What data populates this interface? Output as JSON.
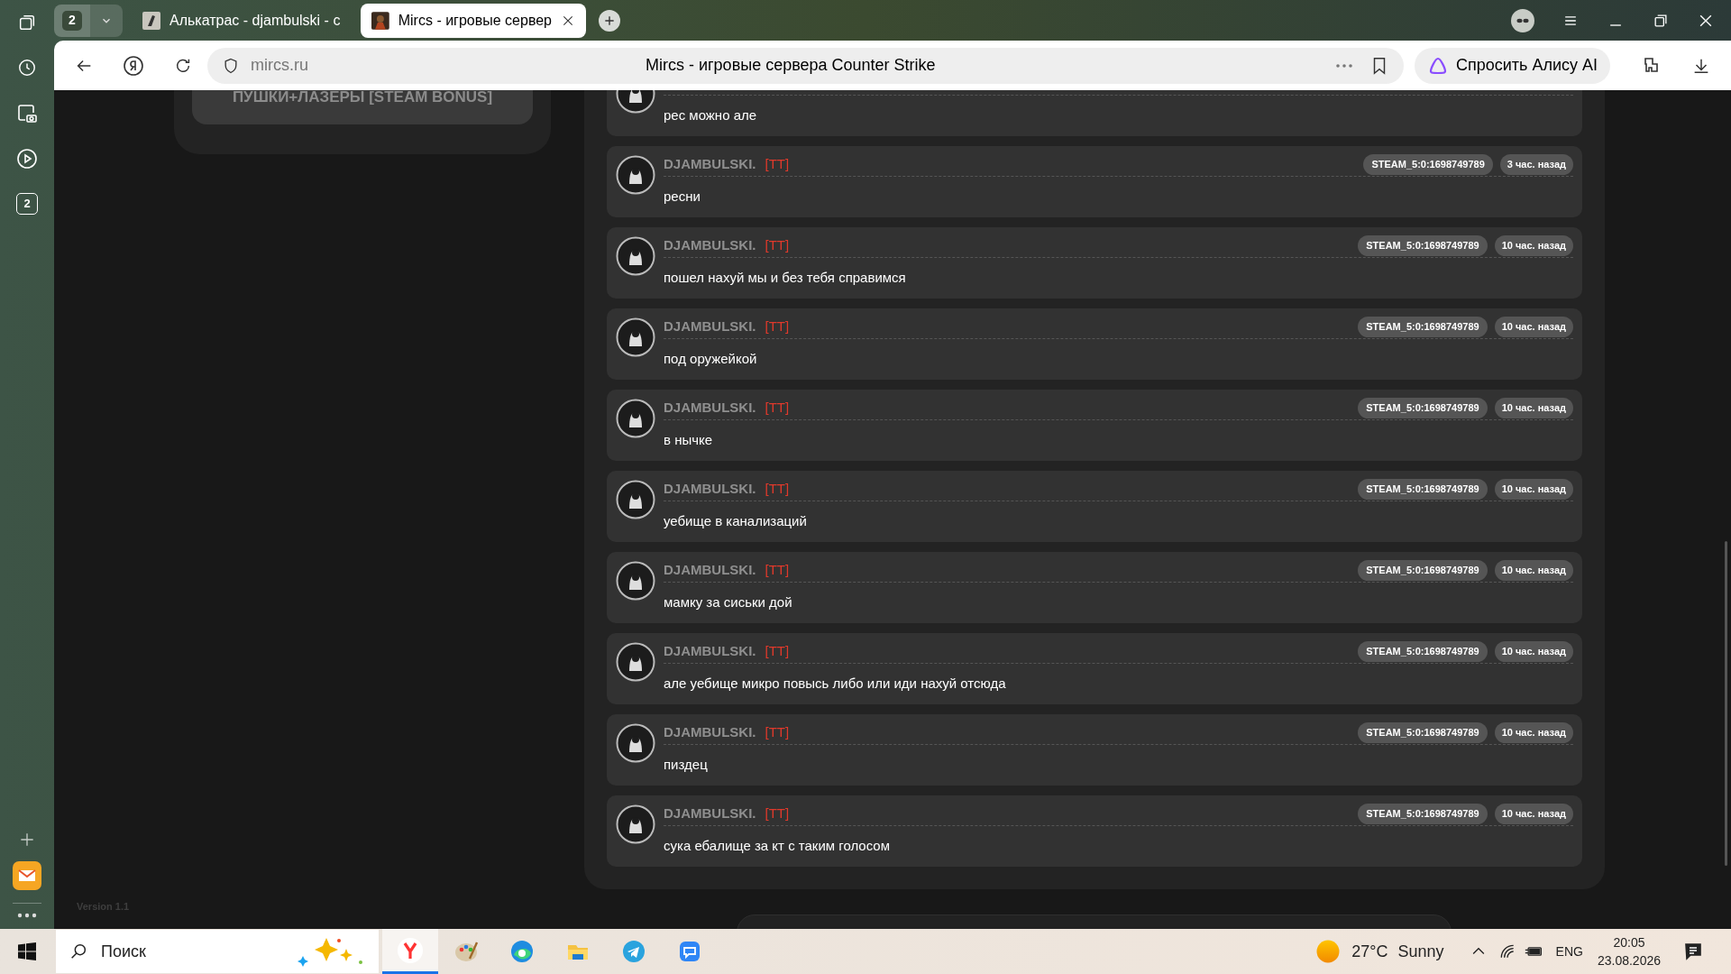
{
  "browser": {
    "tab_count": "2",
    "tabs": [
      {
        "title": "Алькатрас - djambulski - с",
        "selected": false
      },
      {
        "title": "Mircs - игровые сервер",
        "selected": true
      }
    ],
    "address": "mircs.ru",
    "page_title": "Mircs - игровые сервера Counter Strike",
    "assistant_button": "Спросить Алису AI",
    "sidebar_badge": "2"
  },
  "server_panel": {
    "button": "ПУШКИ+ЛАЗЕРЫ [STEAM BONUS]"
  },
  "messages": [
    {
      "text": "рес можно але"
    },
    {
      "name": "DJAMBULSKI.",
      "team": "[TT]",
      "steam_id": "STEAM_5:0:1698749789",
      "time": "3 час. назад",
      "text": "ресни"
    },
    {
      "name": "DJAMBULSKI.",
      "team": "[TT]",
      "steam_id": "STEAM_5:0:1698749789",
      "time": "10 час. назад",
      "text": "пошел нахуй мы и без тебя справимся"
    },
    {
      "name": "DJAMBULSKI.",
      "team": "[TT]",
      "steam_id": "STEAM_5:0:1698749789",
      "time": "10 час. назад",
      "text": "под оружейкой"
    },
    {
      "name": "DJAMBULSKI.",
      "team": "[TT]",
      "steam_id": "STEAM_5:0:1698749789",
      "time": "10 час. назад",
      "text": "в нычке"
    },
    {
      "name": "DJAMBULSKI.",
      "team": "[TT]",
      "steam_id": "STEAM_5:0:1698749789",
      "time": "10 час. назад",
      "text": "уебище в канализаций"
    },
    {
      "name": "DJAMBULSKI.",
      "team": "[TT]",
      "steam_id": "STEAM_5:0:1698749789",
      "time": "10 час. назад",
      "text": "мамку за сиськи дой"
    },
    {
      "name": "DJAMBULSKI.",
      "team": "[TT]",
      "steam_id": "STEAM_5:0:1698749789",
      "time": "10 час. назад",
      "text": "але уебище микро повысь либо или иди нахуй отсюда"
    },
    {
      "name": "DJAMBULSKI.",
      "team": "[TT]",
      "steam_id": "STEAM_5:0:1698749789",
      "time": "10 час. назад",
      "text": "пиздец"
    },
    {
      "name": "DJAMBULSKI.",
      "team": "[TT]",
      "steam_id": "STEAM_5:0:1698749789",
      "time": "10 час. назад",
      "text": "сука ебалище за кт с таким голосом"
    }
  ],
  "version": "Version 1.1",
  "taskbar": {
    "search_placeholder": "Поиск",
    "temperature": "27°C",
    "weather": "Sunny",
    "language": "ENG",
    "time": "20:05",
    "date": "23.08.2026"
  }
}
